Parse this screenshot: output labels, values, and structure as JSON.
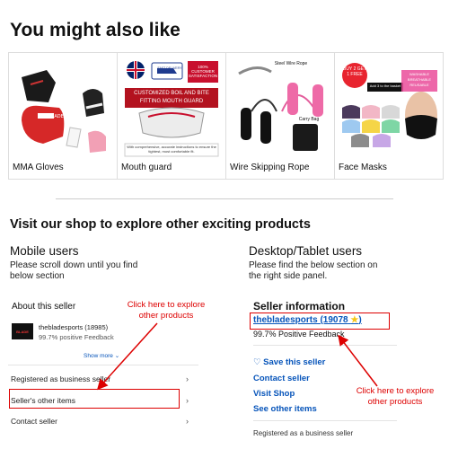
{
  "page": {
    "title": "You might also like"
  },
  "products": [
    {
      "name": "MMA Gloves",
      "icon": "mma-gloves-image"
    },
    {
      "name": "Mouth guard",
      "icon": "mouth-guard-image",
      "badges": [
        "FAST DELIVERY",
        "100% CUSTOMER SATISFACTION"
      ],
      "banner": "CUSTOMIZED BOIL AND BITE FITTING MOUTH GUARD",
      "note": "With comprehensive, accurate instructions to ensure the tightest, most comfortable fit."
    },
    {
      "name": "Wire Skipping Rope",
      "icon": "skipping-rope-image",
      "labels": [
        "Steel Wire Rope",
        "Carry Bag"
      ]
    },
    {
      "name": "Face Masks",
      "icon": "face-masks-image",
      "badges": [
        "BUY 2 GET 1 FREE",
        "Add 3 to the basket",
        "WASHABLE BREATHABLE REUSABLE"
      ]
    }
  ],
  "visit_heading": "Visit our shop to explore other exciting products",
  "mobile": {
    "heading": "Mobile users",
    "instructions": "Please scroll down until you find below section",
    "panel": {
      "title": "About this seller",
      "seller_name": "thebladesports (18985)",
      "feedback": "99.7% positive Feedback",
      "show_more": "Show more",
      "rows": [
        "Registered as business seller",
        "Seller's other items",
        "Contact seller"
      ]
    },
    "callout": "Click here to explore other products"
  },
  "desktop": {
    "heading": "Desktop/Tablet users",
    "instructions": "Please find the below section on the right side panel.",
    "panel": {
      "title": "Seller information",
      "seller_name": "thebladesports (19078",
      "feedback": "99.7% Positive Feedback",
      "save": "Save this seller",
      "links": [
        "Contact seller",
        "Visit Shop",
        "See other items"
      ],
      "footer": "Registered as a business seller"
    },
    "callout": "Click here to explore other products"
  },
  "colors": {
    "callout_red": "#d00000",
    "link_blue": "#0654ba",
    "star_yellow": "#f5c518"
  }
}
